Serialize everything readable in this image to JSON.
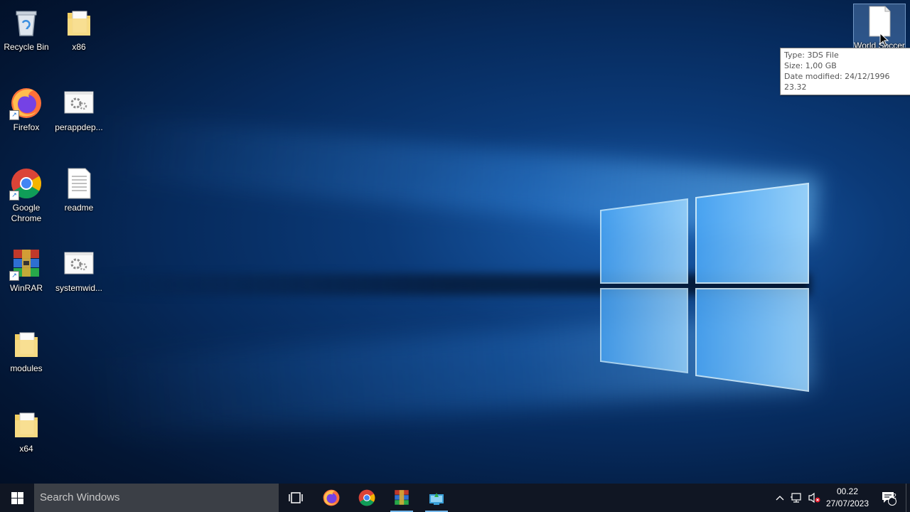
{
  "desktop": {
    "icons": [
      {
        "label": "Recycle Bin",
        "icon": "recycle-bin-icon"
      },
      {
        "label": "x86",
        "icon": "folder-icon"
      },
      {
        "label": "Firefox",
        "icon": "firefox-icon"
      },
      {
        "label": "perappdep...",
        "icon": "settings-file-icon"
      },
      {
        "label": "Google Chrome",
        "icon": "chrome-icon"
      },
      {
        "label": "readme",
        "icon": "text-file-icon"
      },
      {
        "label": "WinRAR",
        "icon": "winrar-icon"
      },
      {
        "label": "systemwid...",
        "icon": "settings-file-icon"
      },
      {
        "label": "modules",
        "icon": "folder-icon"
      },
      {
        "label": "x64",
        "icon": "folder-icon"
      },
      {
        "label": "World Soccer",
        "icon": "blank-file-icon"
      }
    ]
  },
  "tooltip": {
    "type_line": "Type: 3DS File",
    "size_line": "Size: 1,00 GB",
    "date_line": "Date modified: 24/12/1996 23.32"
  },
  "taskbar": {
    "search_placeholder": "Search Windows",
    "pinned": [
      "task-view-icon",
      "firefox-icon",
      "chrome-icon",
      "winrar-icon",
      "app-icon"
    ],
    "clock_time": "00.22",
    "clock_date": "27/07/2023",
    "notification_count": "2"
  },
  "colors": {
    "taskbar_bg": "#101623",
    "search_bg": "#3b3f46",
    "active_indicator": "#76b9ed"
  }
}
